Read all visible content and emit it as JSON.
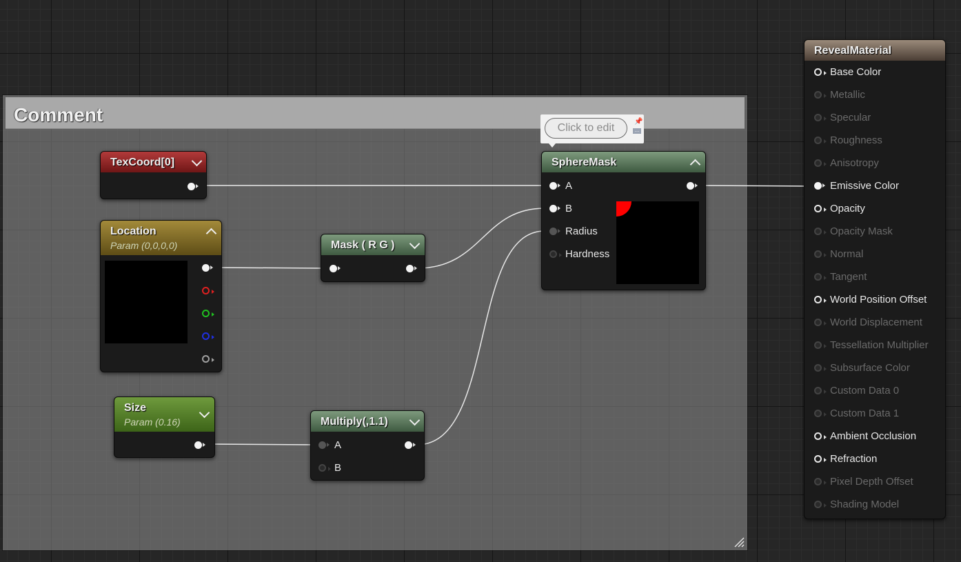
{
  "comment": {
    "title": "Comment"
  },
  "tooltip": {
    "text": "Click to edit"
  },
  "nodes": {
    "texcoord": {
      "title": "TexCoord[0]"
    },
    "location": {
      "title": "Location",
      "subtitle": "Param (0,0,0,0)"
    },
    "mask": {
      "title": "Mask ( R G )"
    },
    "size": {
      "title": "Size",
      "subtitle": "Param (0.16)"
    },
    "multiply": {
      "title": "Multiply(,1.1)",
      "pins": [
        "A",
        "B"
      ]
    },
    "spheremask": {
      "title": "SphereMask",
      "pins": [
        "A",
        "B",
        "Radius",
        "Hardness"
      ]
    },
    "material": {
      "title": "RevealMaterial",
      "pins": [
        "Base Color",
        "Metallic",
        "Specular",
        "Roughness",
        "Anisotropy",
        "Emissive Color",
        "Opacity",
        "Opacity Mask",
        "Normal",
        "Tangent",
        "World Position Offset",
        "World Displacement",
        "Tessellation Multiplier",
        "Subsurface Color",
        "Custom Data 0",
        "Custom Data 1",
        "Ambient Occlusion",
        "Refraction",
        "Pixel Depth Offset",
        "Shading Model"
      ]
    }
  },
  "colors": {
    "texcoord_header": "#8f2a2a",
    "location_header": "#8a7430",
    "mask_header": "#6a876b",
    "size_header": "#5f8a30",
    "material_header": "#7a6a5c",
    "wire": "#e8e8e8",
    "sphere_preview_mark": "#ff0000"
  }
}
